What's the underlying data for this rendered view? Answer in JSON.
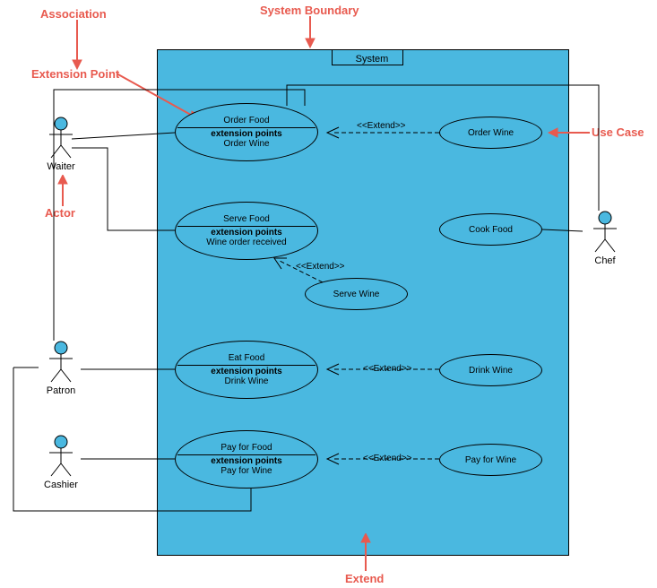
{
  "annotations": {
    "association": "Association",
    "system_boundary": "System Boundary",
    "extension_point": "Extension Point",
    "actor": "Actor",
    "use_case": "Use Case",
    "extend": "Extend"
  },
  "system": {
    "title": "System"
  },
  "actors": {
    "waiter": "Waiter",
    "patron": "Patron",
    "cashier": "Cashier",
    "chef": "Chef"
  },
  "usecases": {
    "order_food": {
      "title": "Order Food",
      "ep_label": "extension points",
      "ep": "Order Wine"
    },
    "serve_food": {
      "title": "Serve Food",
      "ep_label": "extension points",
      "ep": "Wine order received"
    },
    "eat_food": {
      "title": "Eat Food",
      "ep_label": "extension points",
      "ep": "Drink Wine"
    },
    "pay_food": {
      "title": "Pay for Food",
      "ep_label": "extension points",
      "ep": "Pay for Wine"
    },
    "order_wine": "Order Wine",
    "cook_food": "Cook Food",
    "serve_wine": "Serve Wine",
    "drink_wine": "Drink Wine",
    "pay_wine": "Pay for Wine"
  },
  "extend_label": "<<Extend>>"
}
